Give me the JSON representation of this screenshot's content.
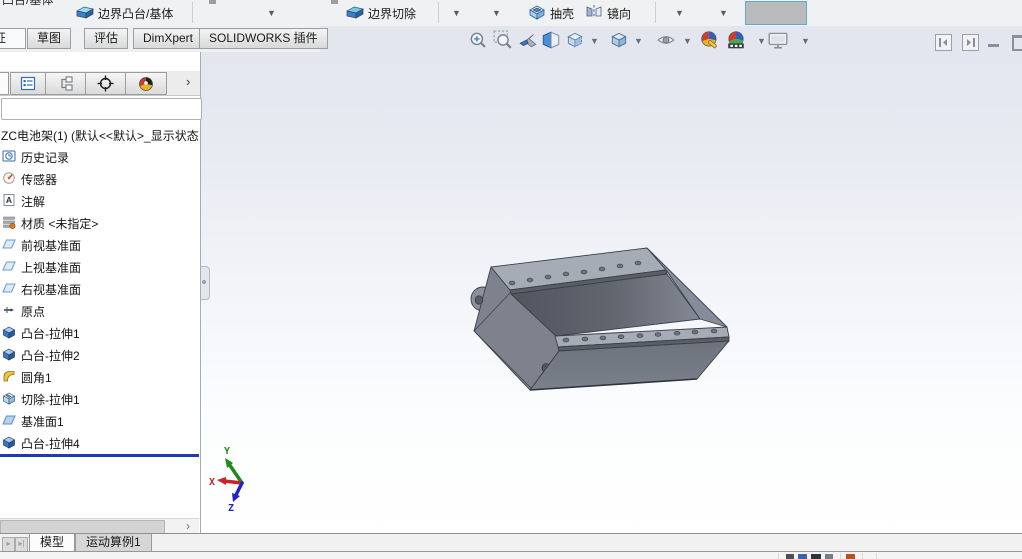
{
  "ribbon": {
    "top_clipped_fragment": "凸台/基体",
    "buttons": [
      {
        "label": "边界凸台/基体",
        "icon": "boundary-boss-icon"
      },
      {
        "label": "边界切除",
        "icon": "boundary-cut-icon"
      },
      {
        "label": "抽壳",
        "icon": "shell-icon"
      },
      {
        "label": "镜向",
        "icon": "mirror-icon"
      }
    ]
  },
  "command_tabs": {
    "items": [
      {
        "label": "特征",
        "active": true
      },
      {
        "label": "草图",
        "active": false
      },
      {
        "label": "评估",
        "active": false
      },
      {
        "label": "DimXpert",
        "active": false
      },
      {
        "label": "SOLIDWORKS 插件",
        "active": false
      }
    ]
  },
  "viewport": {
    "toolbar_icons": [
      "zoom-to-fit",
      "zoom-to-area",
      "previous-view",
      "section-view",
      "view-orientation",
      "display-style",
      "hide-show-items",
      "edit-appearance",
      "apply-scene",
      "view-settings"
    ],
    "window_controls": [
      "collapse-left",
      "collapse-right",
      "minimize",
      "restore"
    ],
    "triad": {
      "x": "X",
      "y": "Y",
      "z": "Z"
    }
  },
  "feature_tree": {
    "panel_tabs": [
      "featuremanager",
      "propertymanager",
      "configurationmanager",
      "dimxpertmanager",
      "displaymanager"
    ],
    "root": "ZC电池架(1) (默认<<默认>_显示状态",
    "items": [
      {
        "label": "历史记录",
        "icon": "history"
      },
      {
        "label": "传感器",
        "icon": "sensors"
      },
      {
        "label": "注解",
        "icon": "annotations"
      },
      {
        "label": "材质 <未指定>",
        "icon": "material"
      },
      {
        "label": "前视基准面",
        "icon": "plane"
      },
      {
        "label": "上视基准面",
        "icon": "plane"
      },
      {
        "label": "右视基准面",
        "icon": "plane"
      },
      {
        "label": "原点",
        "icon": "origin"
      },
      {
        "label": "凸台-拉伸1",
        "icon": "boss-extrude"
      },
      {
        "label": "凸台-拉伸2",
        "icon": "boss-extrude"
      },
      {
        "label": "圆角1",
        "icon": "fillet"
      },
      {
        "label": "切除-拉伸1",
        "icon": "cut-extrude"
      },
      {
        "label": "基准面1",
        "icon": "plane-feature"
      },
      {
        "label": "凸台-拉伸4",
        "icon": "boss-extrude"
      }
    ]
  },
  "bottom_tabs": {
    "items": [
      {
        "label": "模型",
        "active": true
      },
      {
        "label": "运动算例1",
        "active": false
      }
    ]
  },
  "colors": {
    "rollback_bar": "#1f3bb3",
    "model_gray": "#7a7f89",
    "viewport_gradient_top": "#e2e5ee",
    "axis_x": "#cc2222",
    "axis_y": "#1e8a1e",
    "axis_z": "#2222cc"
  }
}
